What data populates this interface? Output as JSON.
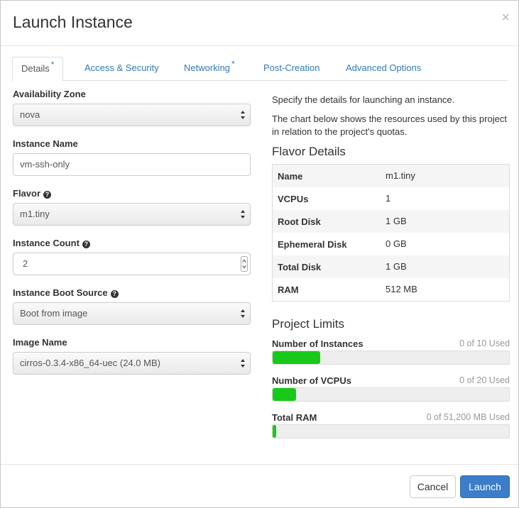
{
  "modal": {
    "title": "Launch Instance",
    "close_glyph": "×"
  },
  "tabs": [
    {
      "label": "Details",
      "required": true,
      "active": true
    },
    {
      "label": "Access & Security",
      "required": false
    },
    {
      "label": "Networking",
      "required": true
    },
    {
      "label": "Post-Creation",
      "required": false
    },
    {
      "label": "Advanced Options",
      "required": false
    }
  ],
  "required_mark": "*",
  "form": {
    "availability_zone": {
      "label": "Availability Zone",
      "value": "nova"
    },
    "instance_name": {
      "label": "Instance Name",
      "value": "vm-ssh-only"
    },
    "flavor": {
      "label": "Flavor",
      "value": "m1.tiny"
    },
    "instance_count": {
      "label": "Instance Count",
      "value": "2"
    },
    "boot_source": {
      "label": "Instance Boot Source",
      "value": "Boot from image"
    },
    "image_name": {
      "label": "Image Name",
      "value": "cirros-0.3.4-x86_64-uec (24.0 MB)"
    }
  },
  "info": {
    "intro": "Specify the details for launching an instance.",
    "chart_note_1": "The chart below shows the resources used by this project",
    "chart_note_2": "in relation to the project's quotas."
  },
  "flavor_details": {
    "heading": "Flavor Details",
    "rows": [
      {
        "key": "Name",
        "value": "m1.tiny"
      },
      {
        "key": "VCPUs",
        "value": "1"
      },
      {
        "key": "Root Disk",
        "value": "1 GB"
      },
      {
        "key": "Ephemeral Disk",
        "value": "0 GB"
      },
      {
        "key": "Total Disk",
        "value": "1 GB"
      },
      {
        "key": "RAM",
        "value": "512 MB"
      }
    ]
  },
  "project_limits": {
    "heading": "Project Limits",
    "items": [
      {
        "label": "Number of Instances",
        "used": "0 of 10 Used",
        "fill_fraction": 0.2
      },
      {
        "label": "Number of VCPUs",
        "used": "0 of 20 Used",
        "fill_fraction": 0.1
      },
      {
        "label": "Total RAM",
        "used": "0 of 51,200 MB Used",
        "fill_fraction": 0.01
      }
    ],
    "fill_color": "#19c919"
  },
  "footer": {
    "cancel_label": "Cancel",
    "launch_label": "Launch"
  },
  "colors": {
    "link": "#337ab7",
    "primary_button": "#3b7dc8"
  }
}
